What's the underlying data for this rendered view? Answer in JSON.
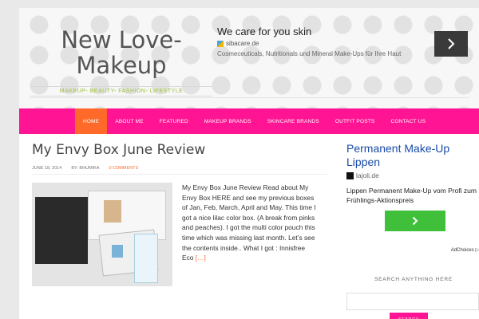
{
  "site": {
    "title": "New Love-Makeup",
    "tagline": "MAKEUP- BEAUTY- FASHION- LIFESTYLE"
  },
  "top_ad": {
    "title": "We care for you skin",
    "domain": "sibacare.de",
    "description": "Cosmeceuticals, Nutritionals und Mineral Make-Ups für Ihre Haut",
    "button_icon": "chevron-right-icon"
  },
  "nav": {
    "items": [
      {
        "label": "HOME",
        "active": true
      },
      {
        "label": "ABOUT ME"
      },
      {
        "label": "FEATURED"
      },
      {
        "label": "MAKEUP BRANDS"
      },
      {
        "label": "SKINCARE BRANDS"
      },
      {
        "label": "OUTFIT POSTS"
      },
      {
        "label": "CONTACT US"
      }
    ],
    "accent_color": "#ff1493",
    "active_color": "#ff6a2a"
  },
  "post": {
    "title": "My Envy Box June Review",
    "date": "JUNE 18, 2014",
    "author": "BY: BHUMIKA",
    "comments": "0 COMMENTS",
    "excerpt": "My Envy Box June Review Read about My Envy Box HERE and see my previous boxes of Jan, Feb, March, April and May. This time I got a nice lilac color box. (A break from pinks and peaches). I got the multi color pouch this time which was missing last month. Let’s see the contents inside.. What I got : Innisfree Eco",
    "more": "[…]"
  },
  "side_ad": {
    "title": "Permanent Make-Up Lippen",
    "domain": "lajoli.de",
    "description": "Lippen Permanent Make-Up vom Profi zum Frühlings-Aktionspreis",
    "button_icon": "chevron-right-icon",
    "adchoices": "AdChoices ▷"
  },
  "search": {
    "heading": "SEARCH ANYTHING HERE",
    "button": "SEARCH",
    "placeholder": ""
  }
}
